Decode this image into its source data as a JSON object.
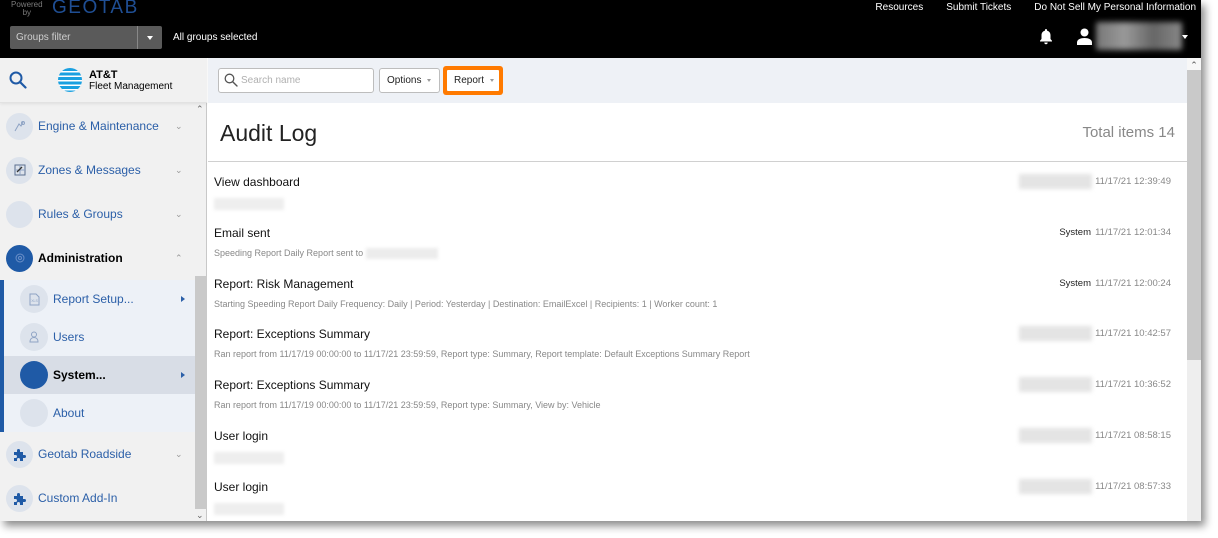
{
  "header": {
    "powered_by": "Powered by",
    "brand": "GEOTAB",
    "groups_filter_placeholder": "Groups filter",
    "groups_status": "All groups selected",
    "links": [
      "Resources",
      "Submit Tickets",
      "Do Not Sell My Personal Information"
    ],
    "icons": {
      "notifications": "bell-icon",
      "user": "user-icon"
    }
  },
  "sidebar": {
    "brand_name": "AT&T",
    "brand_sub": "Fleet Management",
    "items": [
      {
        "label": "Engine & Maintenance",
        "icon": "engine-icon",
        "expanded": false
      },
      {
        "label": "Zones & Messages",
        "icon": "zones-icon",
        "expanded": false
      },
      {
        "label": "Rules & Groups",
        "icon": "rules-icon",
        "expanded": false
      },
      {
        "label": "Administration",
        "icon": "gear-icon",
        "expanded": true,
        "children": [
          {
            "label": "Report Setup...",
            "icon": "report-file-icon",
            "has_submenu": true
          },
          {
            "label": "Users",
            "icon": "user-icon",
            "has_submenu": false
          },
          {
            "label": "System...",
            "icon": "system-icon",
            "has_submenu": true,
            "active": true
          },
          {
            "label": "About",
            "icon": "about-icon",
            "has_submenu": false
          }
        ]
      },
      {
        "label": "Geotab Roadside",
        "icon": "puzzle-icon",
        "expanded": false
      },
      {
        "label": "Custom Add-In",
        "icon": "puzzle-icon",
        "expanded": null
      }
    ]
  },
  "toolbar": {
    "search_placeholder": "Search name",
    "search_value": "",
    "options_label": "Options",
    "report_label": "Report",
    "highlight_color": "#ff7a00"
  },
  "page": {
    "title": "Audit Log",
    "total_items": "Total items 14"
  },
  "entries": [
    {
      "title": "View dashboard",
      "detail": "",
      "user": "",
      "user_redacted": true,
      "detail_redacted": true,
      "timestamp": "11/17/21 12:39:49"
    },
    {
      "title": "Email sent",
      "detail": "Speeding Report Daily Report sent to",
      "detail_suffix_redacted": true,
      "user": "System",
      "timestamp": "11/17/21 12:01:34"
    },
    {
      "title": "Report: Risk Management",
      "detail": "Starting Speeding Report Daily Frequency: Daily | Period: Yesterday | Destination: EmailExcel | Recipients: 1 | Worker count: 1",
      "user": "System",
      "timestamp": "11/17/21 12:00:24"
    },
    {
      "title": "Report: Exceptions Summary",
      "detail": "Ran report from 11/17/19 00:00:00 to 11/17/21 23:59:59, Report type: Summary, Report template: Default Exceptions Summary Report",
      "user": "",
      "user_redacted": true,
      "timestamp": "11/17/21 10:42:57"
    },
    {
      "title": "Report: Exceptions Summary",
      "detail": "Ran report from 11/17/19 00:00:00 to 11/17/21 23:59:59, Report type: Summary, View by: Vehicle",
      "user": "",
      "user_redacted": true,
      "timestamp": "11/17/21 10:36:52"
    },
    {
      "title": "User login",
      "detail": "",
      "detail_redacted": true,
      "user": "",
      "user_redacted": true,
      "timestamp": "11/17/21 08:58:15"
    },
    {
      "title": "User login",
      "detail": "",
      "detail_redacted": true,
      "user": "",
      "user_redacted": true,
      "timestamp": "11/17/21 08:57:33"
    }
  ]
}
